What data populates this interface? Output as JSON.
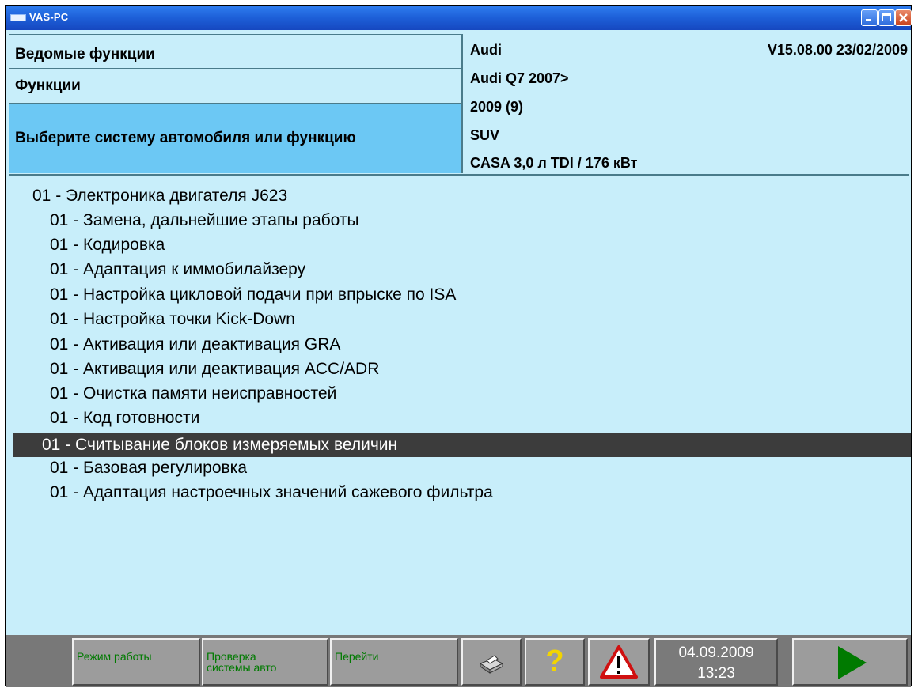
{
  "window": {
    "title": "VAS-PC"
  },
  "header": {
    "left": {
      "row1": "Ведомые функции",
      "row2": "Функции",
      "row3": "Выберите систему автомобиля или функцию"
    },
    "right": {
      "make": "Audi",
      "version": "V15.08.00 23/02/2009",
      "model": "Audi Q7 2007>",
      "year": "2009 (9)",
      "body": "SUV",
      "engine": "CASA 3,0 л TDI / 176 кВт"
    }
  },
  "list": {
    "items": [
      "01 - Электроника двигателя J623",
      "01 - Замена, дальнейшие этапы работы",
      "01 - Кодировка",
      "01 - Адаптация к иммобилайзеру",
      "01 - Настройка цикловой подачи при впрыске по ISA",
      "01 - Настройка точки Kick-Down",
      "01 - Активация или деактивация GRA",
      "01 - Активация или деактивация ACC/ADR",
      "01 - Очистка памяти неисправностей",
      "01 - Код готовности",
      "01 - Считывание блоков измеряемых величин",
      "01 - Базовая регулировка",
      "01 - Адаптация настроечных значений сажевого фильтра"
    ],
    "selected_index": 10
  },
  "bottombar": {
    "mode_label": "Режим работы",
    "check_label_line1": "Проверка",
    "check_label_line2": "системы авто",
    "goto_label": "Перейти",
    "help_label": "?",
    "date": "04.09.2009",
    "time": "13:23",
    "icons": [
      "printer-icon",
      "help-icon",
      "warning-icon",
      "play-icon"
    ],
    "colors": {
      "label_green": "#007a00",
      "selected_row": "#3c3c3c",
      "header_blue": "#6cc8f4"
    }
  }
}
